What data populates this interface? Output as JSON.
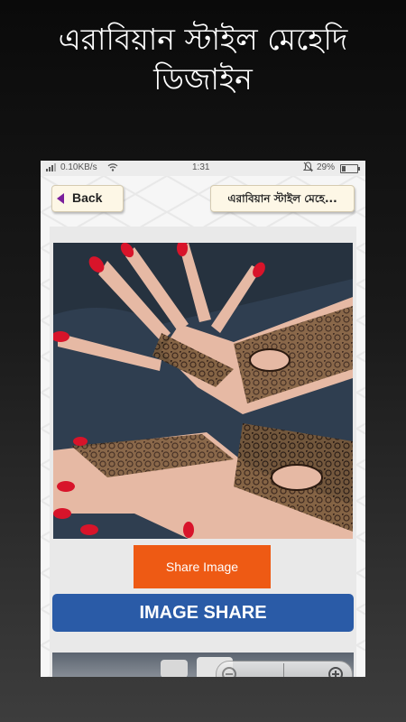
{
  "promo": {
    "title_line1": "এরাবিয়ান স্টাইল মেহেদি",
    "title_line2": "ডিজাইন"
  },
  "status_bar": {
    "speed": "0.10KB/s",
    "time": "1:31",
    "battery": "29%"
  },
  "header": {
    "back_label": "Back",
    "title": "এরাবিয়ান স্টাইল মেহে..."
  },
  "actions": {
    "share_image_label": "Share Image",
    "image_share_label": "IMAGE SHARE"
  },
  "icons": {
    "back": "back-arrow-icon",
    "zoom_out": "zoom-out-icon",
    "zoom_in": "zoom-in-icon"
  },
  "colors": {
    "share_button": "#ee5a14",
    "image_share_button": "#2a5ba7",
    "back_arrow": "#7a1f9c"
  }
}
